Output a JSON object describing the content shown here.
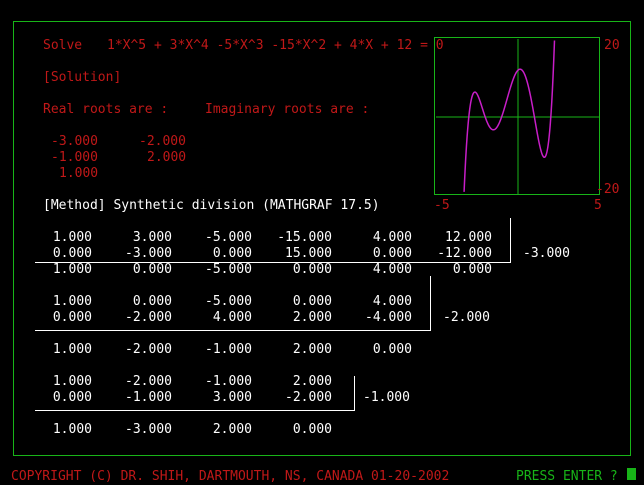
{
  "problem": {
    "solve_label": "Solve",
    "equation": "1*X^5 + 3*X^4 -5*X^3 -15*X^2 + 4*X + 12 = 0",
    "solution_label": "[Solution]",
    "real_roots_label": "Real roots are :",
    "imag_roots_label": "Imaginary roots are :",
    "real_roots": [
      "-3.000",
      "-1.000",
      "1.000"
    ],
    "imag_roots": [
      "-2.000",
      "2.000"
    ]
  },
  "plot": {
    "y_max_label": "20",
    "y_min_label": "-20",
    "x_min_label": "-5",
    "x_max_label": "5",
    "xlim": [
      -5,
      5
    ],
    "ylim": [
      -20,
      20
    ],
    "coefficients": [
      1,
      3,
      -5,
      -15,
      4,
      12
    ],
    "colors": {
      "axes": "#18b418",
      "curve": "#c81ec8"
    }
  },
  "method_label": "[Method] Synthetic division (MATHGRAF 17.5)",
  "division_steps": [
    {
      "rows": [
        [
          "1.000",
          "3.000",
          "-5.000",
          "-15.000",
          "4.000",
          "12.000"
        ],
        [
          "0.000",
          "-3.000",
          "0.000",
          "15.000",
          "0.000",
          "-12.000"
        ],
        [
          "1.000",
          "0.000",
          "-5.000",
          "0.000",
          "4.000",
          "0.000"
        ]
      ],
      "divisor": "-3.000"
    },
    {
      "rows": [
        [
          "1.000",
          "0.000",
          "-5.000",
          "0.000",
          "4.000"
        ],
        [
          "0.000",
          "-2.000",
          "4.000",
          "2.000",
          "-4.000"
        ],
        [
          "1.000",
          "-2.000",
          "-1.000",
          "2.000",
          "0.000"
        ]
      ],
      "divisor": "-2.000"
    },
    {
      "rows": [
        [
          "1.000",
          "-2.000",
          "-1.000",
          "2.000"
        ],
        [
          "0.000",
          "-1.000",
          "3.000",
          "-2.000"
        ],
        [
          "1.000",
          "-3.000",
          "2.000",
          "0.000"
        ]
      ],
      "divisor": "-1.000"
    }
  ],
  "footer": {
    "copyright": "COPYRIGHT (C) DR. SHIH, DARTMOUTH, NS, CANADA 01-20-2002",
    "prompt": "PRESS ENTER ?"
  }
}
